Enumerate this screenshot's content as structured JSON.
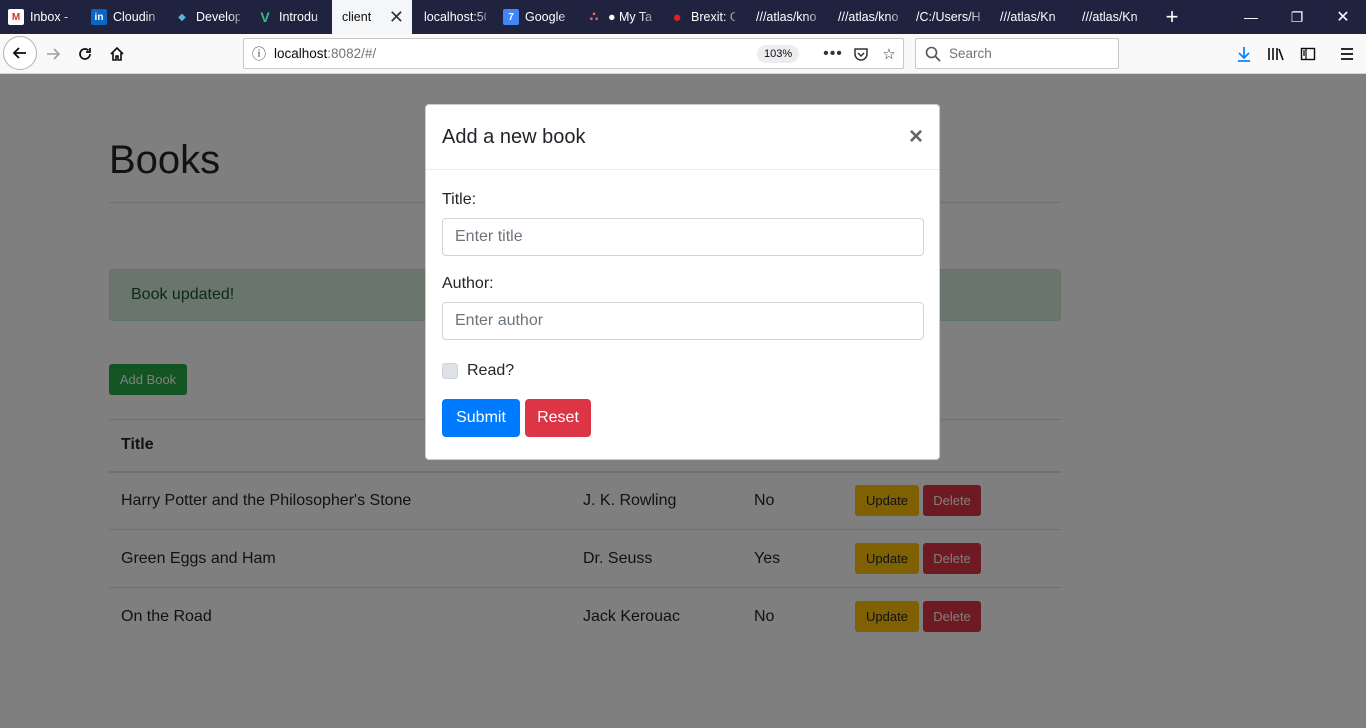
{
  "browser": {
    "tabs": [
      {
        "label": "Inbox -",
        "icon": "gmail-icon",
        "icon_glyph": "M",
        "icon_color": "#d93025"
      },
      {
        "label": "Cloudin",
        "icon": "linkedin-icon",
        "icon_glyph": "in",
        "icon_color": "#0a66c2"
      },
      {
        "label": "Develop",
        "icon": "cube-icon",
        "icon_glyph": "◆",
        "icon_color": "#5fb3d6"
      },
      {
        "label": "Introdu",
        "icon": "vue-icon",
        "icon_glyph": "V",
        "icon_color": "#41b883"
      },
      {
        "label": "client",
        "icon": "",
        "icon_glyph": "",
        "icon_color": ""
      },
      {
        "label": "localhost:50",
        "icon": "",
        "icon_glyph": "",
        "icon_color": ""
      },
      {
        "label": "Google",
        "icon": "calendar-icon",
        "icon_glyph": "7",
        "icon_color": "#4285f4"
      },
      {
        "label": "● My Ta",
        "icon": "asana-icon",
        "icon_glyph": "∴",
        "icon_color": "#f06a6a"
      },
      {
        "label": "Brexit: C",
        "icon": "red-circle-icon",
        "icon_glyph": "●",
        "icon_color": "#e02020"
      },
      {
        "label": "///atlas/kno",
        "icon": "",
        "icon_glyph": "",
        "icon_color": ""
      },
      {
        "label": "///atlas/kno",
        "icon": "",
        "icon_glyph": "",
        "icon_color": ""
      },
      {
        "label": "/C:/Users/H",
        "icon": "",
        "icon_glyph": "",
        "icon_color": ""
      },
      {
        "label": "///atlas/Kn",
        "icon": "",
        "icon_glyph": "",
        "icon_color": ""
      },
      {
        "label": "///atlas/Kn",
        "icon": "",
        "icon_glyph": "",
        "icon_color": ""
      }
    ],
    "active_tab_index": 4,
    "url_host": "localhost",
    "url_rest": ":8082/#/",
    "zoom": "103%",
    "search_placeholder": "Search"
  },
  "page": {
    "title": "Books",
    "alert": "Book updated!",
    "add_button": "Add Book",
    "table": {
      "headers": [
        "Title"
      ],
      "rows": [
        {
          "title": "Harry Potter and the Philosopher's Stone",
          "author": "J. K. Rowling",
          "read": "No"
        },
        {
          "title": "Green Eggs and Ham",
          "author": "Dr. Seuss",
          "read": "Yes"
        },
        {
          "title": "On the Road",
          "author": "Jack Kerouac",
          "read": "No"
        }
      ],
      "update_label": "Update",
      "delete_label": "Delete"
    }
  },
  "modal": {
    "title": "Add a new book",
    "close": "×",
    "title_label": "Title:",
    "title_placeholder": "Enter title",
    "author_label": "Author:",
    "author_placeholder": "Enter author",
    "read_label": "Read?",
    "submit": "Submit",
    "reset": "Reset"
  },
  "colors": {
    "tabbar_bg": "#202340",
    "primary": "#007bff",
    "danger": "#dc3545",
    "warning": "#ffc107",
    "success": "#28a745",
    "alert_bg": "#d4edda"
  }
}
